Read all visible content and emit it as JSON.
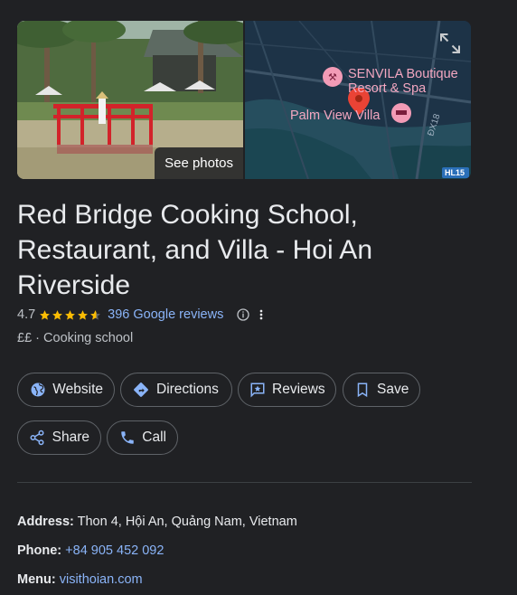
{
  "media": {
    "see_photos_label": "See photos",
    "map_labels": {
      "hotel_1_line1": "SENVILA Boutique",
      "hotel_1_line2": "Resort & Spa",
      "hotel_2": "Palm View Villa",
      "road_1": "ĐX18",
      "road_2": "HL15"
    }
  },
  "place": {
    "title_line1": "Red Bridge Cooking School,",
    "title_line2": "Restaurant, and Villa - Hoi An",
    "title_line3": "Riverside",
    "rating": "4.7",
    "stars_value": 4.7,
    "reviews_label": "396 Google reviews",
    "price": "££",
    "separator": " · ",
    "category": "Cooking school"
  },
  "actions": {
    "website": "Website",
    "directions": "Directions",
    "reviews": "Reviews",
    "save": "Save",
    "share": "Share",
    "call": "Call"
  },
  "details": {
    "address_label": "Address:",
    "address_value": "Thon 4, Hội An, Quảng Nam, Vietnam",
    "phone_label": "Phone:",
    "phone_value": "+84 905 452 092",
    "menu_label": "Menu:",
    "menu_value": "visithoian.com"
  },
  "colors": {
    "background": "#202124",
    "link": "#8ab4f8",
    "star": "#fbbc04",
    "pin": "#ea4335"
  }
}
